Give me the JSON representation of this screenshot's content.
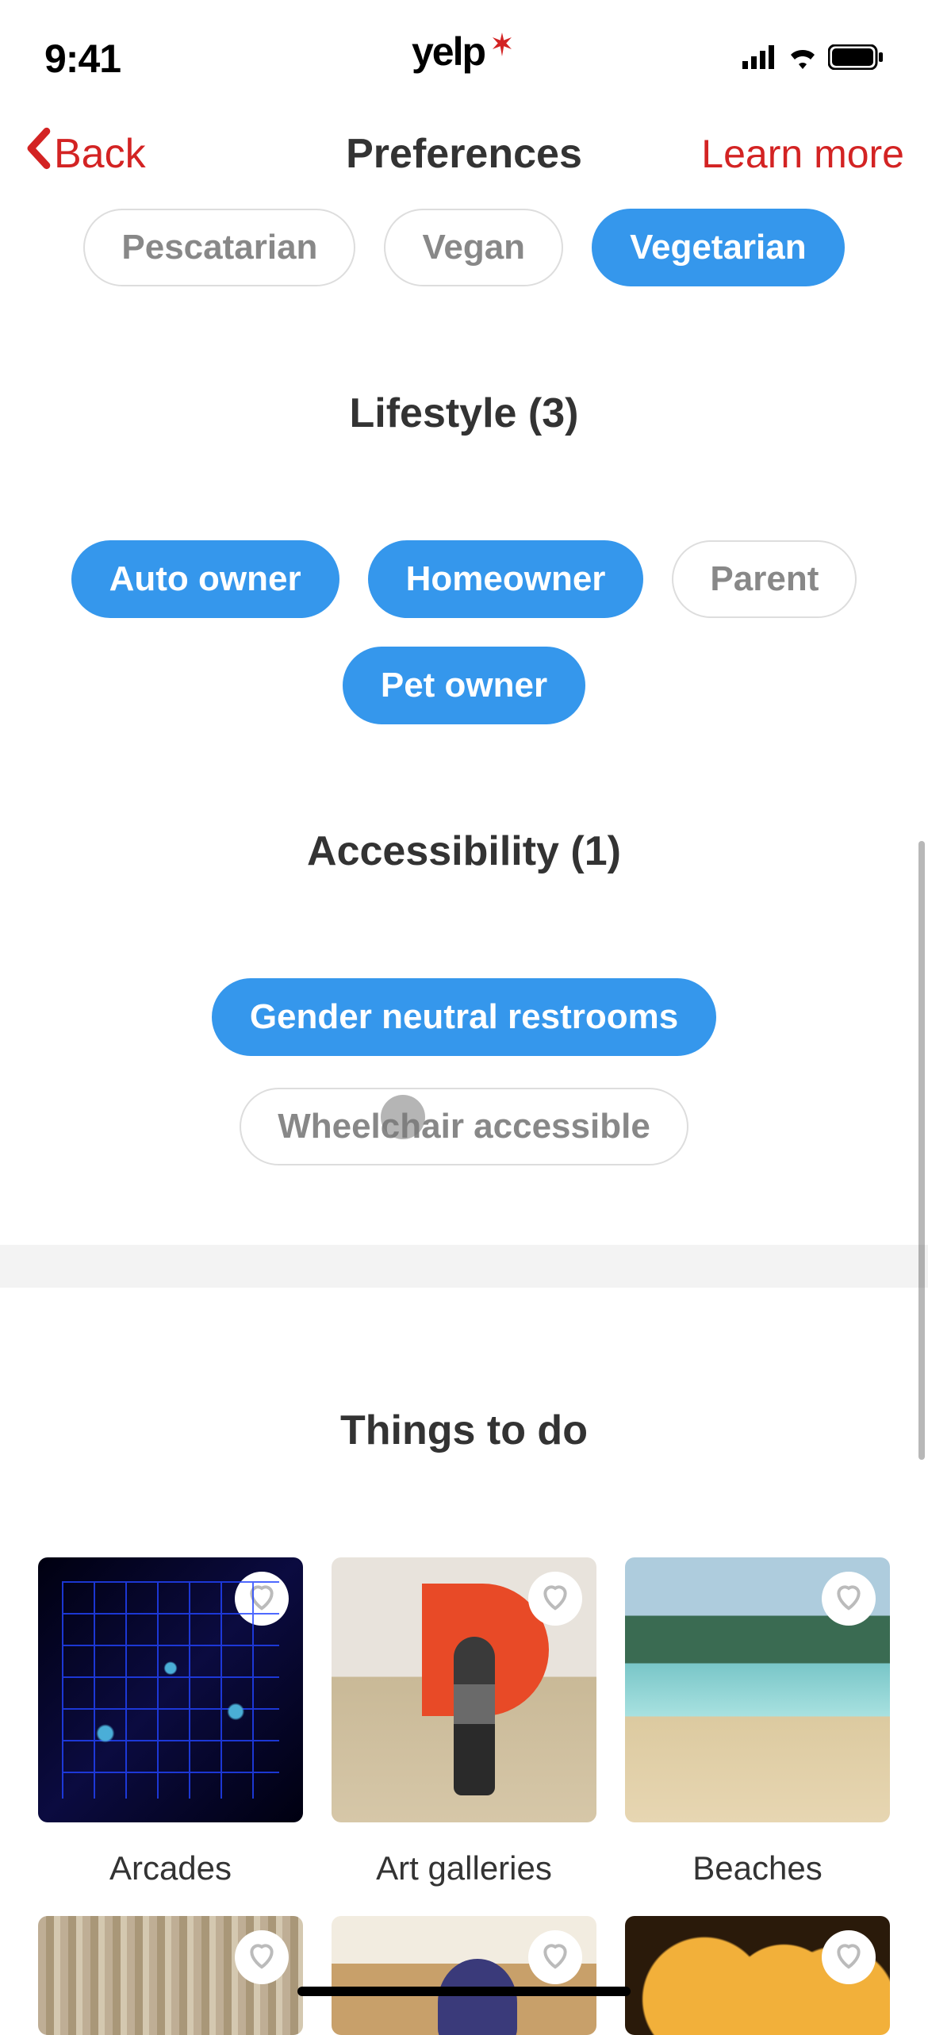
{
  "status": {
    "time": "9:41",
    "logo_text": "yelp"
  },
  "nav": {
    "back_label": "Back",
    "title": "Preferences",
    "learn_more": "Learn more"
  },
  "sections": {
    "dietary_chips": [
      {
        "label": "Pescatarian",
        "selected": false
      },
      {
        "label": "Vegan",
        "selected": false
      },
      {
        "label": "Vegetarian",
        "selected": true
      }
    ],
    "lifestyle": {
      "title": "Lifestyle (3)",
      "chips": [
        {
          "label": "Auto owner",
          "selected": true
        },
        {
          "label": "Homeowner",
          "selected": true
        },
        {
          "label": "Parent",
          "selected": false
        },
        {
          "label": "Pet owner",
          "selected": true
        }
      ]
    },
    "accessibility": {
      "title": "Accessibility (1)",
      "chips": [
        {
          "label": "Gender neutral restrooms",
          "selected": true
        },
        {
          "label": "Wheelchair accessible",
          "selected": false
        }
      ]
    },
    "things": {
      "title": "Things to do",
      "cards": [
        {
          "label": "Arcades",
          "img": "img-arcades"
        },
        {
          "label": "Art galleries",
          "img": "img-art"
        },
        {
          "label": "Beaches",
          "img": "img-beach"
        },
        {
          "label": "",
          "img": "img-bookstore"
        },
        {
          "label": "",
          "img": "img-bowling"
        },
        {
          "label": "",
          "img": "img-brewery"
        }
      ]
    }
  }
}
